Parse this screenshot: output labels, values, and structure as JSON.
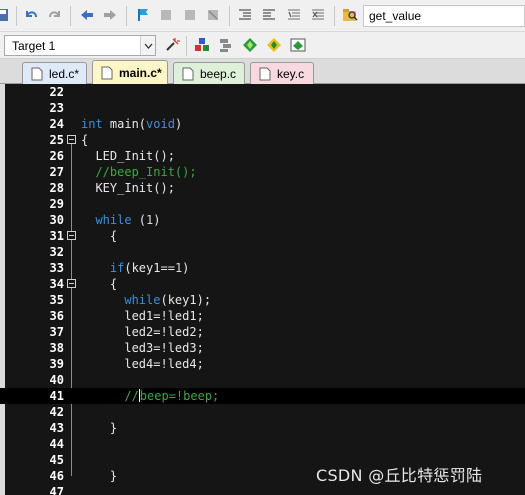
{
  "toolbar": {
    "find_value": "get_value"
  },
  "build_toolbar": {
    "target": "Target 1"
  },
  "tabs": [
    {
      "label": "led.c*",
      "color": "#dfe9f7"
    },
    {
      "label": "main.c*",
      "color": "#fff6c8"
    },
    {
      "label": "beep.c",
      "color": "#dff0d8"
    },
    {
      "label": "key.c",
      "color": "#f7d9df"
    }
  ],
  "editor": {
    "lines": [
      {
        "num": "22",
        "text": ""
      },
      {
        "num": "23",
        "text": ""
      },
      {
        "num": "24",
        "text": "int main(void)"
      },
      {
        "num": "25",
        "text": "{"
      },
      {
        "num": "26",
        "text": "  LED_Init();"
      },
      {
        "num": "27",
        "text": "  //beep_Init();"
      },
      {
        "num": "28",
        "text": "  KEY_Init();"
      },
      {
        "num": "29",
        "text": ""
      },
      {
        "num": "30",
        "text": "  while (1)"
      },
      {
        "num": "31",
        "text": "    {"
      },
      {
        "num": "32",
        "text": ""
      },
      {
        "num": "33",
        "text": "    if(key1==1)"
      },
      {
        "num": "34",
        "text": "    {"
      },
      {
        "num": "35",
        "text": "      while(key1);"
      },
      {
        "num": "36",
        "text": "      led1=!led1;"
      },
      {
        "num": "37",
        "text": "      led2=!led2;"
      },
      {
        "num": "38",
        "text": "      led3=!led3;"
      },
      {
        "num": "39",
        "text": "      led4=!led4;"
      },
      {
        "num": "40",
        "text": ""
      },
      {
        "num": "41",
        "text": "      //beep=!beep;"
      },
      {
        "num": "42",
        "text": ""
      },
      {
        "num": "43",
        "text": "    }"
      },
      {
        "num": "44",
        "text": ""
      },
      {
        "num": "45",
        "text": ""
      },
      {
        "num": "46",
        "text": "    }"
      },
      {
        "num": "47",
        "text": ""
      }
    ]
  },
  "watermark": "CSDN @丘比特惩罚陆",
  "colors": {
    "editor_bg": "#151515",
    "keyword": "#3f8fd8",
    "comment": "#3aa840",
    "text": "#e8e8e8",
    "current_line": "#000000"
  }
}
